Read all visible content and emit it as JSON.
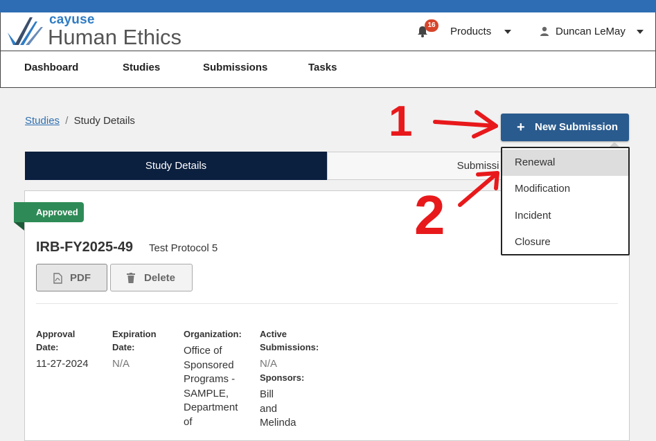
{
  "header": {
    "brand_small": "cayuse",
    "brand_large": "Human Ethics",
    "notification_count": "16",
    "products_label": "Products",
    "user_name": "Duncan LeMay"
  },
  "nav": {
    "items": [
      {
        "label": "Dashboard"
      },
      {
        "label": "Studies"
      },
      {
        "label": "Submissions"
      },
      {
        "label": "Tasks"
      }
    ]
  },
  "breadcrumb": {
    "link": "Studies",
    "separator": "/",
    "current": "Study Details"
  },
  "tabs": [
    {
      "label": "Study Details"
    },
    {
      "label": "Submissi"
    }
  ],
  "study": {
    "status": "Approved",
    "id": "IRB-FY2025-49",
    "title": "Test Protocol 5",
    "pdf_label": "PDF",
    "delete_label": "Delete",
    "fields": {
      "approval_label_1": "Approval",
      "approval_label_2": "Date:",
      "approval_value": "11-27-2024",
      "expiration_label_1": "Expiration",
      "expiration_label_2": "Date:",
      "expiration_value": "N/A",
      "organization_label": "Organization:",
      "organization_lines": [
        "Office of",
        "Sponsored",
        "Programs -",
        "SAMPLE,",
        "Department",
        "of"
      ],
      "active_label_1": "Active",
      "active_label_2": "Submissions:",
      "active_value": "N/A",
      "sponsors_label": "Sponsors:",
      "sponsors_lines": [
        "Bill",
        "and",
        "Melinda"
      ]
    }
  },
  "new_submission": {
    "label": "New Submission",
    "menu": [
      "Renewal",
      "Modification",
      "Incident",
      "Closure"
    ]
  },
  "annotations": {
    "step1": "1",
    "step2": "2"
  },
  "colors": {
    "topbar": "#2e6db4",
    "tab_active": "#0b1f3f",
    "approved": "#2e8b57",
    "new_submission": "#2a5b8e",
    "annotation": "#e8191b"
  }
}
